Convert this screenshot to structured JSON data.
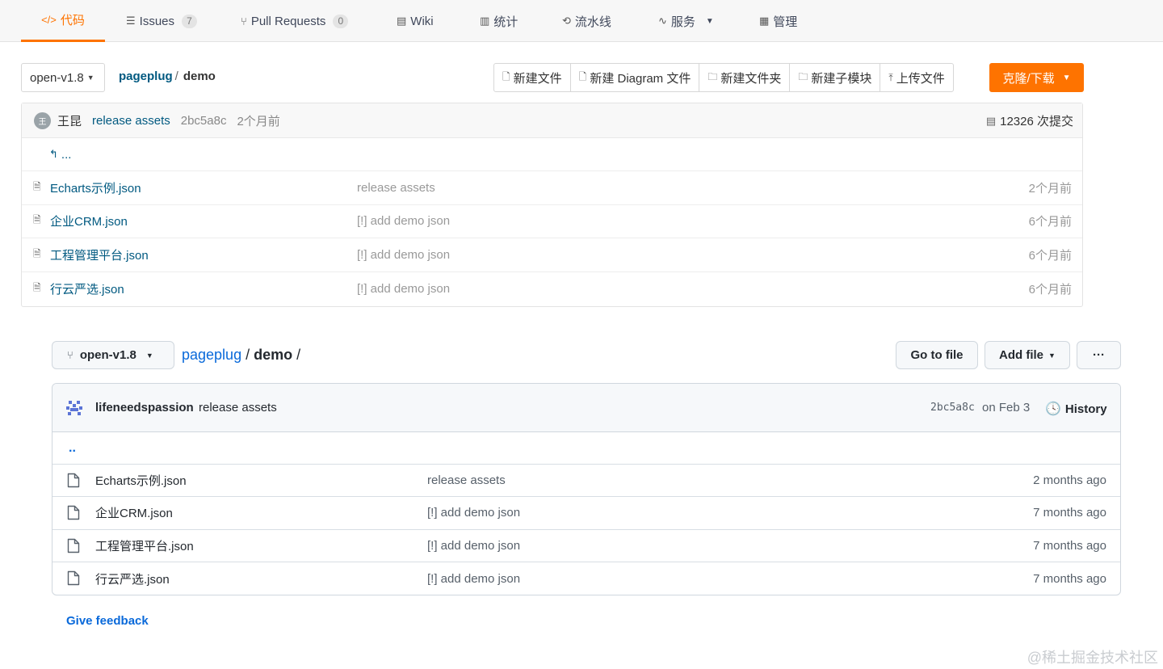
{
  "gitee": {
    "nav": [
      {
        "icon": "</>",
        "label": "代码"
      },
      {
        "icon": "☰",
        "label": "Issues",
        "count": "7"
      },
      {
        "icon": "⑂",
        "label": "Pull Requests",
        "count": "0"
      },
      {
        "icon": "▤",
        "label": "Wiki"
      },
      {
        "icon": "▥",
        "label": "统计"
      },
      {
        "icon": "⟲",
        "label": "流水线"
      },
      {
        "icon": "∿",
        "label": "服务"
      },
      {
        "icon": "▦",
        "label": "管理"
      }
    ],
    "branch": "open-v1.8",
    "owner": "pageplug",
    "separator": "/",
    "repo": "demo",
    "actions": [
      "新建文件",
      "新建 Diagram 文件",
      "新建文件夹",
      "新建子模块",
      "上传文件"
    ],
    "clone_label": "克隆/下载",
    "commit": {
      "avatar_text": "王",
      "author": "王昆",
      "message": "release assets",
      "sha": "2bc5a8c",
      "time": "2个月前",
      "count_label": "12326 次提交"
    },
    "parent_label": "...",
    "files": [
      {
        "name": "Echarts示例.json",
        "message": "release assets",
        "time": "2个月前"
      },
      {
        "name": "企业CRM.json",
        "message": "[!] add demo json",
        "time": "6个月前"
      },
      {
        "name": "工程管理平台.json",
        "message": "[!] add demo json",
        "time": "6个月前"
      },
      {
        "name": "行云严选.json",
        "message": "[!] add demo json",
        "time": "6个月前"
      }
    ]
  },
  "github": {
    "branch": "open-v1.8",
    "owner": "pageplug",
    "sep1": " / ",
    "repo": "demo",
    "sep2": " /",
    "goto_label": "Go to file",
    "addfile_label": "Add file",
    "more_label": "···",
    "commit": {
      "author": "lifeneedspassion",
      "message": "release assets",
      "sha": "2bc5a8c",
      "date": "on Feb 3",
      "history_label": "History"
    },
    "parent_label": "..",
    "files": [
      {
        "name": "Echarts示例.json",
        "message": "release assets",
        "time": "2 months ago"
      },
      {
        "name": "企业CRM.json",
        "message": "[!] add demo json",
        "time": "7 months ago"
      },
      {
        "name": "工程管理平台.json",
        "message": "[!] add demo json",
        "time": "7 months ago"
      },
      {
        "name": "行云严选.json",
        "message": "[!] add demo json",
        "time": "7 months ago"
      }
    ],
    "feedback_label": "Give feedback"
  },
  "watermark": "@稀土掘金技术社区",
  "colors": {
    "gitee_accent": "#fe7300",
    "gitee_link": "#005980",
    "github_link": "#0969da"
  }
}
